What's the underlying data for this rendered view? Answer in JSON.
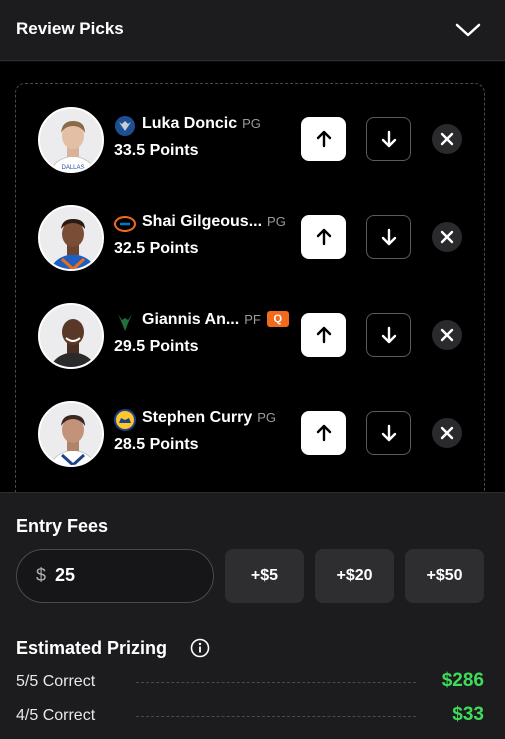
{
  "header": {
    "title": "Review Picks",
    "collapse_icon": "chevron-down-icon"
  },
  "picks": [
    {
      "name": "Luka Doncic",
      "position": "PG",
      "line": "33.5 Points",
      "team_logo": "mavericks-logo-icon",
      "jersey_color": "#ffffff",
      "injury_badge": ""
    },
    {
      "name": "Shai Gilgeous...",
      "position": "PG",
      "line": "32.5 Points",
      "team_logo": "thunder-logo-icon",
      "jersey_color": "#1f5fbf",
      "injury_badge": ""
    },
    {
      "name": "Giannis An...",
      "position": "PF",
      "line": "29.5 Points",
      "team_logo": "bucks-logo-icon",
      "jersey_color": "#ffffff",
      "injury_badge": "Q"
    },
    {
      "name": "Stephen Curry",
      "position": "PG",
      "line": "28.5 Points",
      "team_logo": "warriors-logo-icon",
      "jersey_color": "#ffffff",
      "injury_badge": ""
    }
  ],
  "entry_fees": {
    "title": "Entry Fees",
    "currency": "$",
    "value": "25",
    "quick_adds": [
      "+$5",
      "+$20",
      "+$50"
    ]
  },
  "prizing": {
    "title": "Estimated Prizing",
    "rows": [
      {
        "label": "5/5 Correct",
        "amount": "$286"
      },
      {
        "label": "4/5 Correct",
        "amount": "$33"
      }
    ]
  },
  "colors": {
    "accent_green": "#3fdc5a",
    "badge_orange": "#f26a1b",
    "background": "#000000"
  }
}
